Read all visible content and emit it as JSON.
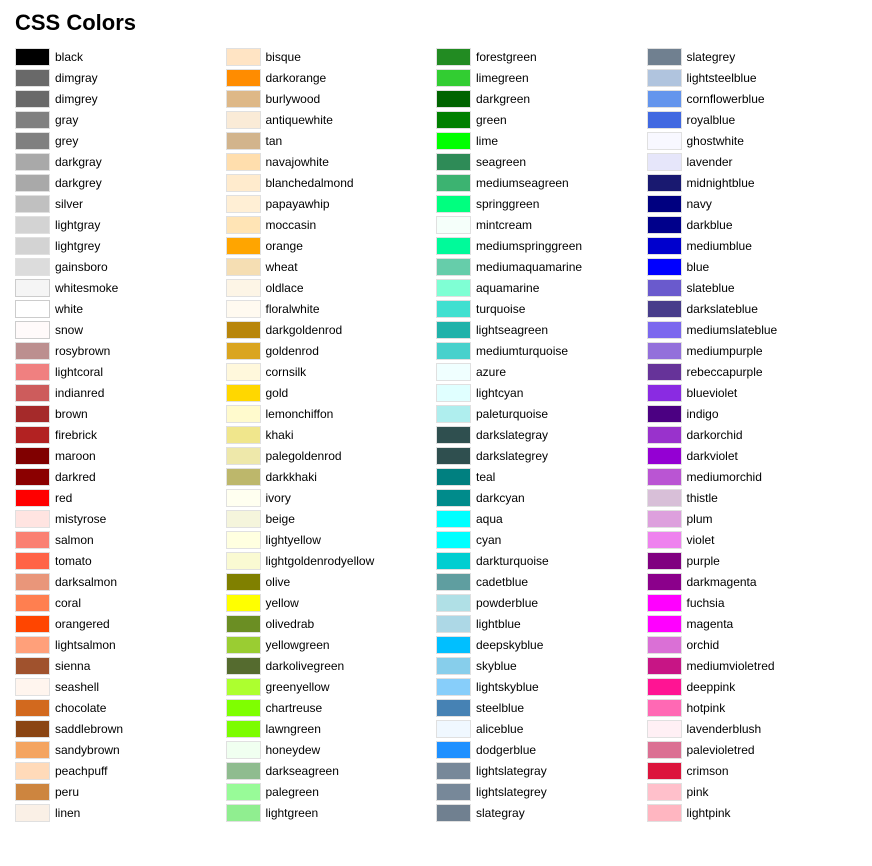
{
  "title": "CSS Colors",
  "colors": [
    [
      "black",
      "#000000"
    ],
    [
      "dimgray",
      "#696969"
    ],
    [
      "dimgrey",
      "#696969"
    ],
    [
      "gray",
      "#808080"
    ],
    [
      "grey",
      "#808080"
    ],
    [
      "darkgray",
      "#a9a9a9"
    ],
    [
      "darkgrey",
      "#a9a9a9"
    ],
    [
      "silver",
      "#c0c0c0"
    ],
    [
      "lightgray",
      "#d3d3d3"
    ],
    [
      "lightgrey",
      "#d3d3d3"
    ],
    [
      "gainsboro",
      "#dcdcdc"
    ],
    [
      "whitesmoke",
      "#f5f5f5"
    ],
    [
      "white",
      "#ffffff"
    ],
    [
      "snow",
      "#fffafa"
    ],
    [
      "rosybrown",
      "#bc8f8f"
    ],
    [
      "lightcoral",
      "#f08080"
    ],
    [
      "indianred",
      "#cd5c5c"
    ],
    [
      "brown",
      "#a52a2a"
    ],
    [
      "firebrick",
      "#b22222"
    ],
    [
      "maroon",
      "#800000"
    ],
    [
      "darkred",
      "#8b0000"
    ],
    [
      "red",
      "#ff0000"
    ],
    [
      "mistyrose",
      "#ffe4e1"
    ],
    [
      "salmon",
      "#fa8072"
    ],
    [
      "tomato",
      "#ff6347"
    ],
    [
      "darksalmon",
      "#e9967a"
    ],
    [
      "coral",
      "#ff7f50"
    ],
    [
      "orangered",
      "#ff4500"
    ],
    [
      "lightsalmon",
      "#ffa07a"
    ],
    [
      "sienna",
      "#a0522d"
    ],
    [
      "seashell",
      "#fff5ee"
    ],
    [
      "chocolate",
      "#d2691e"
    ],
    [
      "saddlebrown",
      "#8b4513"
    ],
    [
      "sandybrown",
      "#f4a460"
    ],
    [
      "peachpuff",
      "#ffdab9"
    ],
    [
      "peru",
      "#cd853f"
    ],
    [
      "linen",
      "#faf0e6"
    ],
    [
      "bisque",
      "#ffe4c4"
    ],
    [
      "darkorange",
      "#ff8c00"
    ],
    [
      "burlywood",
      "#deb887"
    ],
    [
      "antiquewhite",
      "#faebd7"
    ],
    [
      "tan",
      "#d2b48c"
    ],
    [
      "navajowhite",
      "#ffdead"
    ],
    [
      "blanchedalmond",
      "#ffebcd"
    ],
    [
      "papayawhip",
      "#ffefd5"
    ],
    [
      "moccasin",
      "#ffe4b5"
    ],
    [
      "orange",
      "#ffa500"
    ],
    [
      "wheat",
      "#f5deb3"
    ],
    [
      "oldlace",
      "#fdf5e6"
    ],
    [
      "floralwhite",
      "#fffaf0"
    ],
    [
      "darkgoldenrod",
      "#b8860b"
    ],
    [
      "goldenrod",
      "#daa520"
    ],
    [
      "cornsilk",
      "#fff8dc"
    ],
    [
      "gold",
      "#ffd700"
    ],
    [
      "lemonchiffon",
      "#fffacd"
    ],
    [
      "khaki",
      "#f0e68c"
    ],
    [
      "palegoldenrod",
      "#eee8aa"
    ],
    [
      "darkkhaki",
      "#bdb76b"
    ],
    [
      "ivory",
      "#fffff0"
    ],
    [
      "beige",
      "#f5f5dc"
    ],
    [
      "lightyellow",
      "#ffffe0"
    ],
    [
      "lightgoldenrodyellow",
      "#fafad2"
    ],
    [
      "olive",
      "#808000"
    ],
    [
      "yellow",
      "#ffff00"
    ],
    [
      "olivedrab",
      "#6b8e23"
    ],
    [
      "yellowgreen",
      "#9acd32"
    ],
    [
      "darkolivegreen",
      "#556b2f"
    ],
    [
      "greenyellow",
      "#adff2f"
    ],
    [
      "chartreuse",
      "#7fff00"
    ],
    [
      "lawngreen",
      "#7cfc00"
    ],
    [
      "honeydew",
      "#f0fff0"
    ],
    [
      "darkseagreen",
      "#8fbc8f"
    ],
    [
      "palegreen",
      "#98fb98"
    ],
    [
      "lightgreen",
      "#90ee90"
    ],
    [
      "forestgreen",
      "#228b22"
    ],
    [
      "limegreen",
      "#32cd32"
    ],
    [
      "darkgreen",
      "#006400"
    ],
    [
      "green",
      "#008000"
    ],
    [
      "lime",
      "#00ff00"
    ],
    [
      "seagreen",
      "#2e8b57"
    ],
    [
      "mediumseagreen",
      "#3cb371"
    ],
    [
      "springgreen",
      "#00ff7f"
    ],
    [
      "mintcream",
      "#f5fffa"
    ],
    [
      "mediumspringgreen",
      "#00fa9a"
    ],
    [
      "mediumaquamarine",
      "#66cdaa"
    ],
    [
      "aquamarine",
      "#7fffd4"
    ],
    [
      "turquoise",
      "#40e0d0"
    ],
    [
      "lightseagreen",
      "#20b2aa"
    ],
    [
      "mediumturquoise",
      "#48d1cc"
    ],
    [
      "azure",
      "#f0ffff"
    ],
    [
      "lightcyan",
      "#e0ffff"
    ],
    [
      "paleturquoise",
      "#afeeee"
    ],
    [
      "darkslategray",
      "#2f4f4f"
    ],
    [
      "darkslategrey",
      "#2f4f4f"
    ],
    [
      "teal",
      "#008080"
    ],
    [
      "darkcyan",
      "#008b8b"
    ],
    [
      "aqua",
      "#00ffff"
    ],
    [
      "cyan",
      "#00ffff"
    ],
    [
      "darkturquoise",
      "#00ced1"
    ],
    [
      "cadetblue",
      "#5f9ea0"
    ],
    [
      "powderblue",
      "#b0e0e6"
    ],
    [
      "lightblue",
      "#add8e6"
    ],
    [
      "deepskyblue",
      "#00bfff"
    ],
    [
      "skyblue",
      "#87ceeb"
    ],
    [
      "lightskyblue",
      "#87cefa"
    ],
    [
      "steelblue",
      "#4682b4"
    ],
    [
      "aliceblue",
      "#f0f8ff"
    ],
    [
      "dodgerblue",
      "#1e90ff"
    ],
    [
      "lightslategray",
      "#778899"
    ],
    [
      "lightslategrey",
      "#778899"
    ],
    [
      "slategray",
      "#708090"
    ],
    [
      "slategrey",
      "#708090"
    ],
    [
      "lightsteelblue",
      "#b0c4de"
    ],
    [
      "cornflowerblue",
      "#6495ed"
    ],
    [
      "royalblue",
      "#4169e1"
    ],
    [
      "ghostwhite",
      "#f8f8ff"
    ],
    [
      "lavender",
      "#e6e6fa"
    ],
    [
      "midnightblue",
      "#191970"
    ],
    [
      "navy",
      "#000080"
    ],
    [
      "darkblue",
      "#00008b"
    ],
    [
      "mediumblue",
      "#0000cd"
    ],
    [
      "blue",
      "#0000ff"
    ],
    [
      "slateblue",
      "#6a5acd"
    ],
    [
      "darkslateblue",
      "#483d8b"
    ],
    [
      "mediumslateblue",
      "#7b68ee"
    ],
    [
      "mediumpurple",
      "#9370db"
    ],
    [
      "rebeccapurple",
      "#663399"
    ],
    [
      "blueviolet",
      "#8a2be2"
    ],
    [
      "indigo",
      "#4b0082"
    ],
    [
      "darkorchid",
      "#9932cc"
    ],
    [
      "darkviolet",
      "#9400d3"
    ],
    [
      "mediumorchid",
      "#ba55d3"
    ],
    [
      "thistle",
      "#d8bfd8"
    ],
    [
      "plum",
      "#dda0dd"
    ],
    [
      "violet",
      "#ee82ee"
    ],
    [
      "purple",
      "#800080"
    ],
    [
      "darkmagenta",
      "#8b008b"
    ],
    [
      "fuchsia",
      "#ff00ff"
    ],
    [
      "magenta",
      "#ff00ff"
    ],
    [
      "orchid",
      "#da70d6"
    ],
    [
      "mediumvioletred",
      "#c71585"
    ],
    [
      "deeppink",
      "#ff1493"
    ],
    [
      "hotpink",
      "#ff69b4"
    ],
    [
      "lavenderblush",
      "#fff0f5"
    ],
    [
      "palevioletred",
      "#db7093"
    ],
    [
      "crimson",
      "#dc143c"
    ],
    [
      "pink",
      "#ffc0cb"
    ],
    [
      "lightpink",
      "#ffb6c1"
    ]
  ]
}
